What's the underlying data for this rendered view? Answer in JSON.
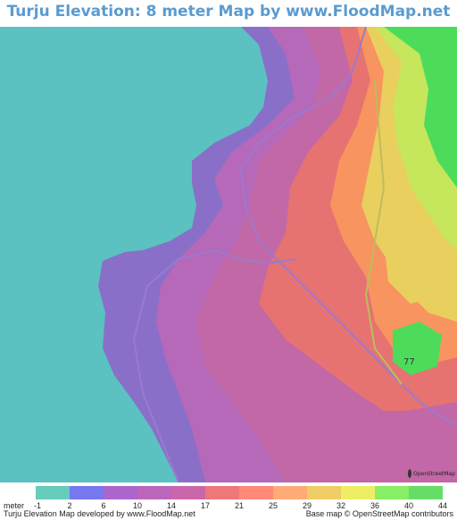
{
  "title": "Turju Elevation: 8 meter Map by www.FloodMap.net (beta)",
  "colors": {
    "sea": "#5bc1c1",
    "title": "#5a9bd0"
  },
  "map": {
    "road_label": "77",
    "osm_logo_text": "OpenStreetMap"
  },
  "legend": {
    "unit": "meter",
    "labels": [
      "-1",
      "2",
      "6",
      "10",
      "14",
      "17",
      "21",
      "25",
      "29",
      "32",
      "36",
      "40",
      "44"
    ],
    "colors": [
      "#66ccbb",
      "#7777ee",
      "#aa66cc",
      "#bb66bb",
      "#cc66aa",
      "#ee7777",
      "#ff8877",
      "#ffaa77",
      "#eecc66",
      "#eeee66",
      "#88ee66",
      "#66dd66"
    ]
  },
  "footer": {
    "left": "Turju Elevation Map developed by www.FloodMap.net",
    "right": "Base map © OpenStreetMap contributors"
  }
}
